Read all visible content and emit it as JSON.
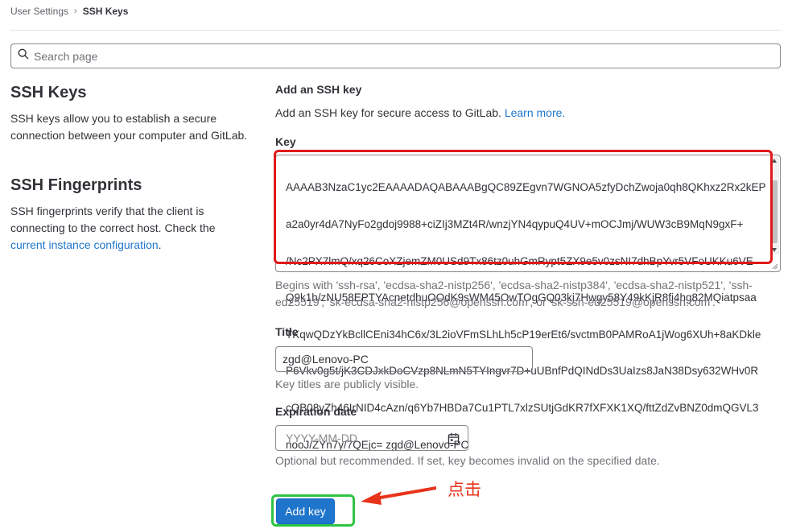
{
  "breadcrumb": {
    "parent": "User Settings",
    "separator": "›",
    "current": "SSH Keys"
  },
  "search": {
    "placeholder": "Search page"
  },
  "sidebar": {
    "ssh_keys_title": "SSH Keys",
    "ssh_keys_desc_line1": "SSH keys allow you to establish a secure",
    "ssh_keys_desc_line2": "connection between your computer and GitLab.",
    "fingerprints_title": "SSH Fingerprints",
    "fingerprints_desc_line1": "SSH fingerprints verify that the client is",
    "fingerprints_desc_line2": "connecting to the correct host. Check the",
    "fingerprints_link": "current instance configuration",
    "fingerprints_link_suffix": "."
  },
  "form": {
    "heading": "Add an SSH key",
    "intro_text": "Add an SSH key for secure access to GitLab.",
    "learn_more": "Learn more.",
    "key_label": "Key",
    "key_lines": [
      "AAAAB3NzaC1yc2EAAAADAQABAAABgQC89ZEgvn7WGNOA5zfyDchZwoja0qh8QKhxz2Rx2kEP",
      "a2a0yr4dA7NyFo2gdoj9988+ciZIj3MZt4R/wnzjYN4qypuQ4UV+mOCJmj/WUW3cB9MqN9gxF+",
      "/Nc2PX7lmQ/xq26CoXZjemZM0USd9Tx86tz0uhGmRypt5ZX9e5v0zsNI7dhBpYvr5VFoUKKu6VE",
      "Q9k1h/zNU58EPTYAcnetdhuOOdK9sWM45OwTOgGQ03kj7Hwgy58Y49kKjR8fj4hg82MQiatpsaa",
      "TKqwQDzYkBcllCEni34hC6x/3L2ioVFmSLhLh5cP19erEt6/svctmB0PAMRoA1jWog6XUh+8aKDkle",
      "P6Vkv0g5t/jK3CDJxkDoCVzp8NLmN5TYIngvr7D+uUBnfPdQINdDs3UaIzs8JaN38Dsy632WHv0R",
      "cQB08yZh46IrNID4cAzn/q6Yb7HBDa7Cu1PTL7xlzSUtjGdKR7fXFXK1XQ/fttZdZvBNZ0dmQGVL3",
      "nooJ/ZYn7y/7QEjc= zgd@Lenovo-PC"
    ],
    "key_help_line1": "Begins with 'ssh-rsa', 'ecdsa-sha2-nistp256', 'ecdsa-sha2-nistp384', 'ecdsa-sha2-nistp521', 'ssh-",
    "key_help_line2": "ed25519', 'sk-ecdsa-sha2-nistp256@openssh.com', or 'sk-ssh-ed25519@openssh.com'.",
    "title_label": "Title",
    "title_value": "zgd@Lenovo-PC",
    "title_help": "Key titles are publicly visible.",
    "expiration_label": "Expiration date",
    "expiration_placeholder": "YYYY-MM-DD",
    "expiration_help": "Optional but recommended. If set, key becomes invalid on the specified date.",
    "submit_label": "Add key"
  },
  "annotation": {
    "click_note": "点击"
  },
  "colors": {
    "primary": "#1f75cb",
    "highlight_red": "#e01919",
    "highlight_green": "#2fc443",
    "note_red": "#e8331b"
  },
  "icons": [
    "search-icon",
    "calendar-icon"
  ]
}
